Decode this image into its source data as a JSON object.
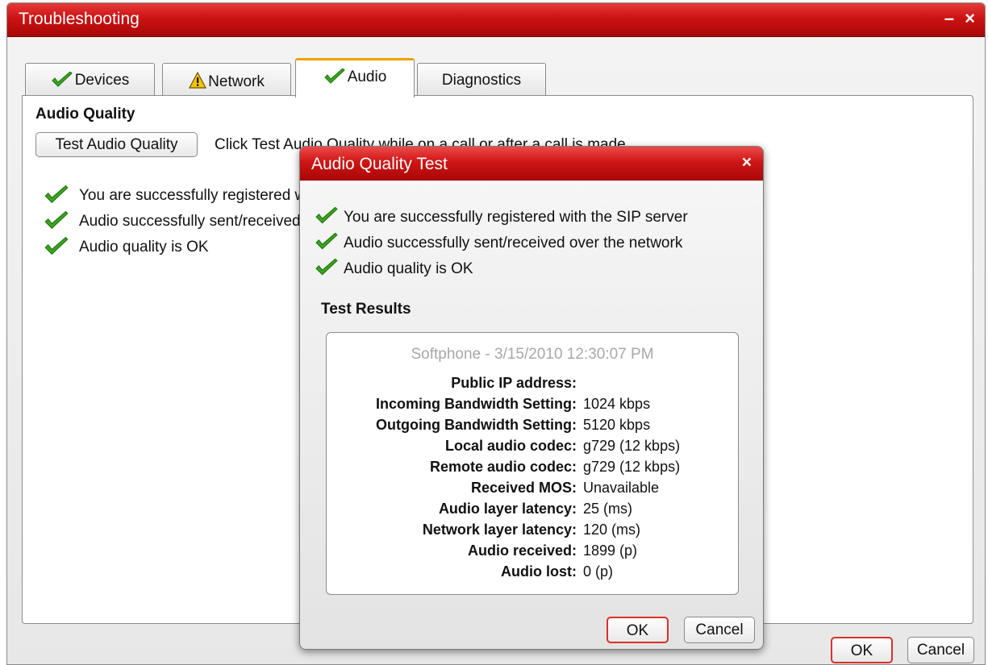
{
  "window": {
    "title": "Troubleshooting",
    "minimize_label": "–",
    "close_label": "×"
  },
  "tabs": [
    {
      "label": "Devices",
      "icon": "check-icon",
      "active": false
    },
    {
      "label": "Network",
      "icon": "warning-icon",
      "active": false
    },
    {
      "label": "Audio",
      "icon": "check-icon",
      "active": true
    },
    {
      "label": "Diagnostics",
      "icon": "",
      "active": false
    }
  ],
  "audio": {
    "section_title": "Audio Quality",
    "test_button": "Test Audio Quality",
    "hint": "Click Test Audio Quality while on a call or after a call is made.",
    "statuses": [
      "You are successfully registered with the SIP server",
      "Audio successfully sent/received over the network",
      "Audio quality is OK"
    ]
  },
  "footer": {
    "ok_label": "OK",
    "cancel_label": "Cancel"
  },
  "dialog": {
    "title": "Audio Quality Test",
    "close_label": "×",
    "statuses": [
      "You are successfully registered with the SIP server",
      "Audio successfully sent/received over the network",
      "Audio quality is OK"
    ],
    "results_title": "Test Results",
    "results_header": "Softphone - 3/15/2010 12:30:07 PM",
    "results": [
      {
        "key": "Public IP address:",
        "value": ""
      },
      {
        "key": "Incoming Bandwidth Setting:",
        "value": "1024 kbps"
      },
      {
        "key": "Outgoing Bandwidth Setting:",
        "value": "5120 kbps"
      },
      {
        "key": "Local audio codec:",
        "value": "g729 (12 kbps)"
      },
      {
        "key": "Remote audio codec:",
        "value": "g729 (12 kbps)"
      },
      {
        "key": "Received MOS:",
        "value": "Unavailable"
      },
      {
        "key": "Audio layer latency:",
        "value": "25 (ms)"
      },
      {
        "key": "Network layer latency:",
        "value": "120 (ms)"
      },
      {
        "key": "Audio received:",
        "value": "1899 (p)"
      },
      {
        "key": "Audio lost:",
        "value": "0 (p)"
      }
    ],
    "ok_label": "OK",
    "cancel_label": "Cancel"
  },
  "colors": {
    "title_red": "#cc1212",
    "active_tab_accent": "#f0a000",
    "check_green": "#3aa81f",
    "primary_button_border": "#d8302c"
  }
}
